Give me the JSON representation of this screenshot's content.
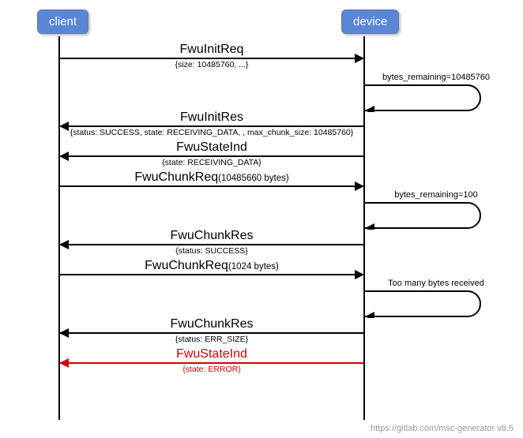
{
  "actors": {
    "client": "client",
    "device": "device"
  },
  "messages": {
    "m1": {
      "label": "FwuInitReq",
      "sub": "{size: 10485760, ...}"
    },
    "loop1": "bytes_remaining=10485760",
    "m2": {
      "label": "FwuInitRes",
      "sub": "{status: SUCCESS, state: RECEIVING_DATA, , max_chunk_size: 10485760}"
    },
    "m3": {
      "label": "FwuStateInd",
      "sub": "{state: RECEIVING_DATA}"
    },
    "m4": {
      "label": "FwuChunkReq",
      "size": "(10485660 bytes)"
    },
    "loop2": "bytes_remaining=100",
    "m5": {
      "label": "FwuChunkRes",
      "sub": "{status: SUCCESS}"
    },
    "m6": {
      "label": "FwuChunkReq",
      "size": "(1024 bytes)"
    },
    "loop3": "Too many bytes received",
    "m7": {
      "label": "FwuChunkRes",
      "sub": "{status: ERR_SIZE}"
    },
    "m8": {
      "label": "FwuStateInd",
      "sub": "{state: ERROR}"
    }
  },
  "footer": "https://gitlab.com/msc-generator v8.5",
  "chart_data": {
    "type": "sequence_diagram",
    "actors": [
      "client",
      "device"
    ],
    "events": [
      {
        "from": "client",
        "to": "device",
        "name": "FwuInitReq",
        "params": "{size: 10485760, ...}"
      },
      {
        "from": "device",
        "to": "device",
        "name": "bytes_remaining=10485760"
      },
      {
        "from": "device",
        "to": "client",
        "name": "FwuInitRes",
        "params": "{status: SUCCESS, state: RECEIVING_DATA, , max_chunk_size: 10485760}"
      },
      {
        "from": "device",
        "to": "client",
        "name": "FwuStateInd",
        "params": "{state: RECEIVING_DATA}"
      },
      {
        "from": "client",
        "to": "device",
        "name": "FwuChunkReq",
        "params": "(10485660 bytes)"
      },
      {
        "from": "device",
        "to": "device",
        "name": "bytes_remaining=100"
      },
      {
        "from": "device",
        "to": "client",
        "name": "FwuChunkRes",
        "params": "{status: SUCCESS}"
      },
      {
        "from": "client",
        "to": "device",
        "name": "FwuChunkReq",
        "params": "(1024 bytes)"
      },
      {
        "from": "device",
        "to": "device",
        "name": "Too many bytes received"
      },
      {
        "from": "device",
        "to": "client",
        "name": "FwuChunkRes",
        "params": "{status: ERR_SIZE}"
      },
      {
        "from": "device",
        "to": "client",
        "name": "FwuStateInd",
        "params": "{state: ERROR}",
        "error": true
      }
    ]
  }
}
